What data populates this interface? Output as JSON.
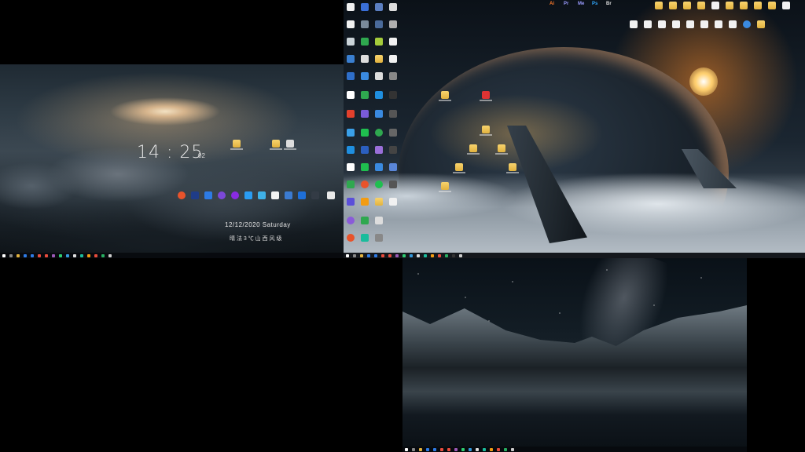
{
  "left_monitor": {
    "clock_time": "14 : 25",
    "clock_seconds": "02",
    "date_line": "12/12/2020 Saturday",
    "weather_line": "晴 法 3 ℃  山 西 风 级"
  },
  "center_monitor": {
    "top_app_labels": [
      "Ai",
      "Pr",
      "Me",
      "Ps",
      "Br"
    ]
  },
  "colors": {
    "folder": "#f0c24e",
    "taskbar": "#0a0d12",
    "sun": "#ffd070"
  }
}
